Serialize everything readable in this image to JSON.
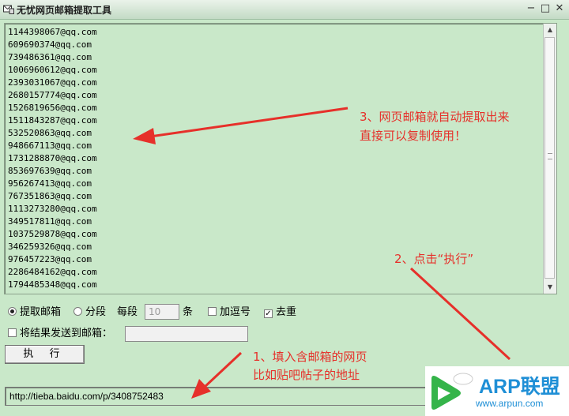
{
  "window": {
    "title": "无忧网页邮箱提取工具",
    "min_icon": "minimize-icon",
    "max_icon": "maximize-icon",
    "close_icon": "close-icon"
  },
  "email_list": [
    "1144398067@qq.com",
    "609690374@qq.com",
    "739486361@qq.com",
    "1006960612@qq.com",
    "2393031067@qq.com",
    "2680157774@qq.com",
    "1526819656@qq.com",
    "1511843287@qq.com",
    "532520863@qq.com",
    "948667113@qq.com",
    "1731288870@qq.com",
    "853697639@qq.com",
    "956267413@qq.com",
    "767351863@qq.com",
    "1113273280@qq.com",
    "349517811@qq.com",
    "1037529878@qq.com",
    "346259326@qq.com",
    "976457223@qq.com",
    "2286484162@qq.com",
    "1794485348@qq.com"
  ],
  "options": {
    "extract_label": "提取邮箱",
    "segment_label": "分段",
    "per_segment_label": "每段",
    "per_segment_value": "10",
    "unit_label": "条",
    "add_comma_label": "加逗号",
    "dedupe_label": "去重",
    "send_label": "将结果发送到邮箱：",
    "send_email_value": "",
    "execute_label": "执 行"
  },
  "url_input_value": "http://tieba.baidu.com/p/3408752483",
  "annotations": {
    "step3_line1": "3、网页邮箱就自动提取出来",
    "step3_line2": "直接可以复制使用！",
    "step2": "2、点击“执行”",
    "step1_line1": "1、填入含邮箱的网页",
    "step1_line2": "比如贴吧帖子的地址"
  },
  "watermark": {
    "brand": "ARP联盟",
    "url": "www.arpun.com"
  },
  "colors": {
    "background": "#c9e8c9",
    "annotation": "#e6302a",
    "brand": "#1f8fd6"
  }
}
